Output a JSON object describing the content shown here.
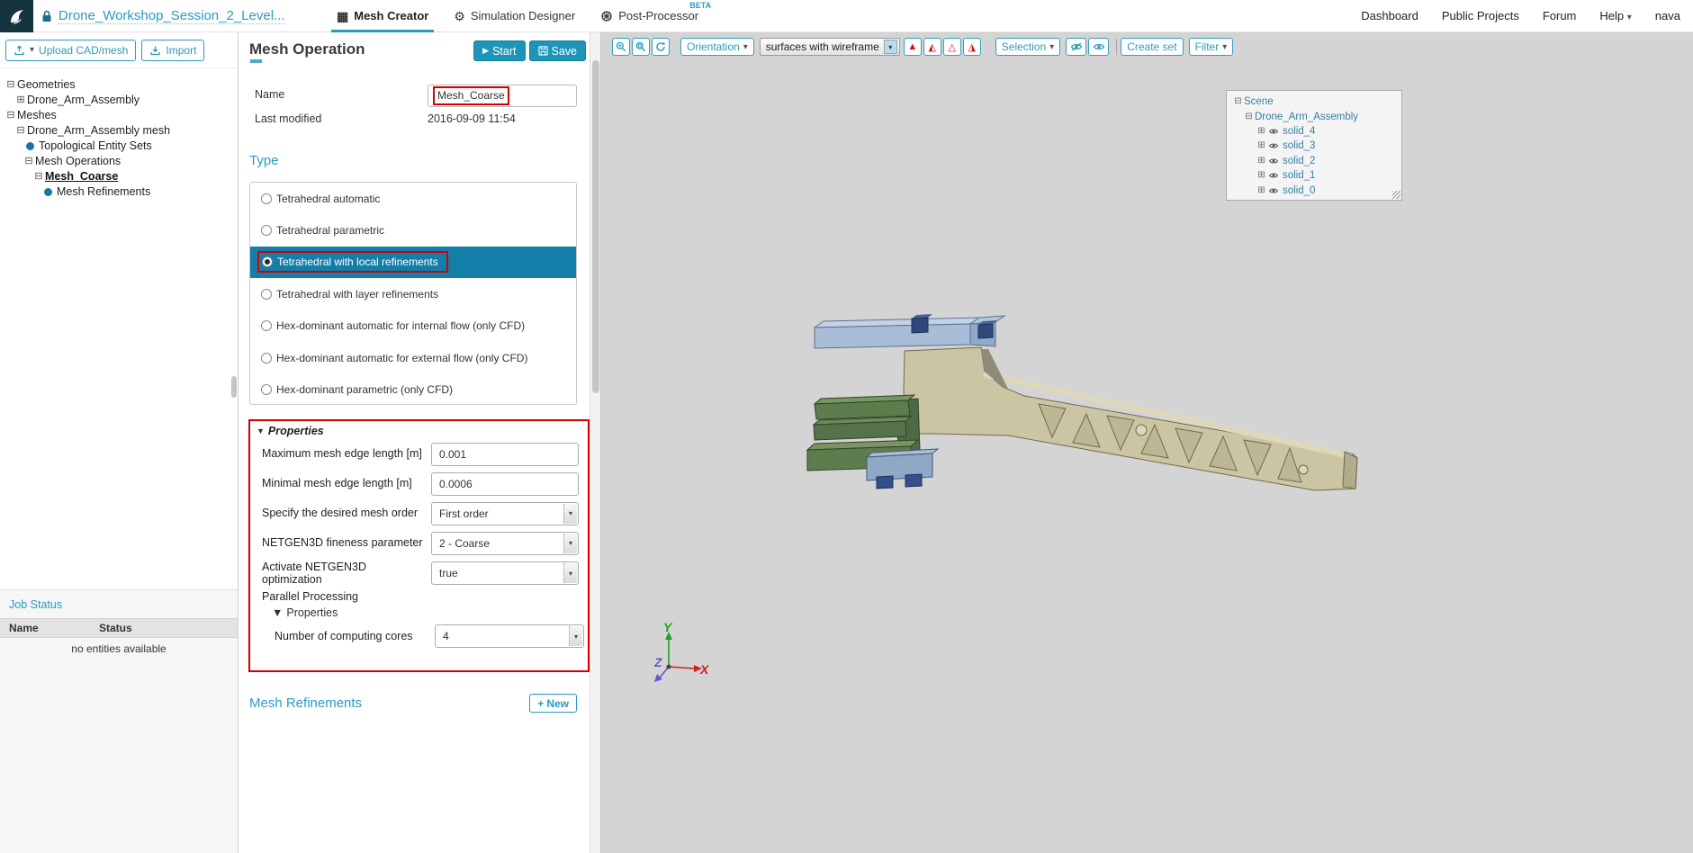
{
  "icons": {
    "caret_down": "▾",
    "grid": "▦",
    "gear": "⚙",
    "collapse": "⊟",
    "expand": "⊞",
    "section_triangle": "▼",
    "play": "▶",
    "plus": "+",
    "tri_filled": "▲",
    "tri_half_left": "◭",
    "tri_outline": "△",
    "tri_half_right": "◮"
  },
  "header": {
    "project_title": "Drone_Workshop_Session_2_Level...",
    "tabs": [
      {
        "label": "Mesh Creator"
      },
      {
        "label": "Simulation Designer"
      },
      {
        "label": "Post-Processor",
        "badge": "BETA"
      }
    ],
    "nav": [
      "Dashboard",
      "Public Projects",
      "Forum",
      "Help",
      "nava"
    ]
  },
  "sidebar": {
    "upload_button": "Upload CAD/mesh",
    "import_button": "Import",
    "tree": [
      {
        "label": "Geometries"
      },
      {
        "label": "Drone_Arm_Assembly"
      },
      {
        "label": "Meshes"
      },
      {
        "label": "Drone_Arm_Assembly mesh"
      },
      {
        "label": "Topological Entity Sets"
      },
      {
        "label": "Mesh Operations"
      },
      {
        "label": "Mesh_Coarse"
      },
      {
        "label": "Mesh Refinements"
      }
    ],
    "job_status": {
      "title": "Job Status",
      "columns": [
        "Name",
        "Status"
      ],
      "empty": "no entities available"
    }
  },
  "panel": {
    "title": "Mesh Operation",
    "start_button": "Start",
    "save_button": "Save",
    "name_label": "Name",
    "name_value": "Mesh_Coarse",
    "last_modified_label": "Last modified",
    "last_modified_value": "2016-09-09 11:54",
    "type_heading": "Type",
    "type_options": [
      "Tetrahedral automatic",
      "Tetrahedral parametric",
      "Tetrahedral with local refinements",
      "Tetrahedral with layer refinements",
      "Hex-dominant automatic for internal flow (only CFD)",
      "Hex-dominant automatic for external flow (only CFD)",
      "Hex-dominant parametric (only CFD)"
    ],
    "properties": {
      "heading": "Properties",
      "rows": [
        {
          "label": "Maximum mesh edge length [m]",
          "value": "0.001"
        },
        {
          "label": "Minimal mesh edge length [m]",
          "value": "0.0006"
        },
        {
          "label": "Specify the desired mesh order",
          "value": "First order"
        },
        {
          "label": "NETGEN3D fineness parameter",
          "value": "2 - Coarse"
        },
        {
          "label": "Activate NETGEN3D optimization",
          "value": "true"
        }
      ],
      "parallel_label": "Parallel Processing",
      "sub_heading": "Properties",
      "cores_label": "Number of computing cores",
      "cores_value": "4"
    },
    "refinements_heading": "Mesh Refinements",
    "new_button": "New"
  },
  "viewport": {
    "toolbar": {
      "orientation": "Orientation",
      "render_mode": "surfaces with wireframe",
      "selection": "Selection",
      "create_set": "Create set",
      "filter": "Filter"
    },
    "scene_tree": {
      "root": "Scene",
      "assembly": "Drone_Arm_Assembly",
      "solids": [
        "solid_4",
        "solid_3",
        "solid_2",
        "solid_1",
        "solid_0"
      ]
    },
    "axes": {
      "x": "X",
      "y": "Y",
      "z": "Z"
    }
  }
}
